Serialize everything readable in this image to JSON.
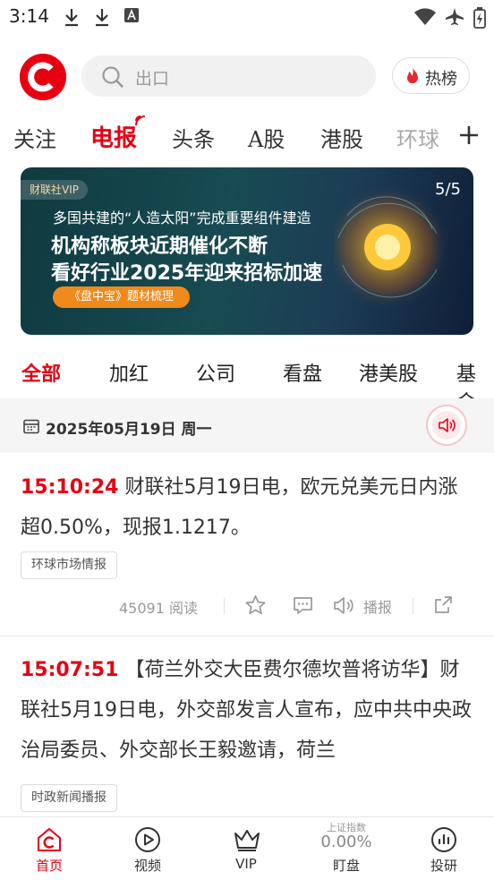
{
  "status_bar": {
    "time": "3:14"
  },
  "header": {
    "search_placeholder": "出口",
    "hot_label": "热榜"
  },
  "channel_tabs": [
    "关注",
    "电报",
    "头条",
    "A股",
    "港股",
    "环球"
  ],
  "active_channel": "电报",
  "banner": {
    "vip_label": "财联社VIP",
    "counter": "5/5",
    "subtitle": "多国共建的“人造太阳”完成重要组件建造",
    "title_line1": "机构称板块近期催化不断",
    "title_line2": "看好行业2025年迎来招标加速",
    "pill": "《盘中宝》题材梳理"
  },
  "category_tabs": [
    "全部",
    "加红",
    "公司",
    "看盘",
    "港美股",
    "基金"
  ],
  "active_category": "全部",
  "date_bar": {
    "date": "2025年05月19日 周一"
  },
  "news": [
    {
      "time": "15:10:24",
      "text": "财联社5月19日电，欧元兑美元日内涨超0.50%，现报1.1217。",
      "tag": "环球市场情报",
      "reads": "45091 阅读",
      "broadcast": "播报"
    },
    {
      "time": "15:07:51",
      "text": "【荷兰外交大臣费尔德坎普将访华】财联社5月19日电，外交部发言人宣布，应中共中央政治局委员、外交部长王毅邀请，荷兰",
      "tag": "时政新闻播报"
    }
  ],
  "bottom_nav": {
    "home": "首页",
    "video": "视频",
    "vip": "VIP",
    "index_name": "上证指数",
    "index_value": "0.00%",
    "market": "盯盘",
    "research": "投研"
  },
  "colors": {
    "brand_red": "#e60012",
    "background": "#ffffff",
    "date_bar_bg": "#f5f5f5"
  }
}
